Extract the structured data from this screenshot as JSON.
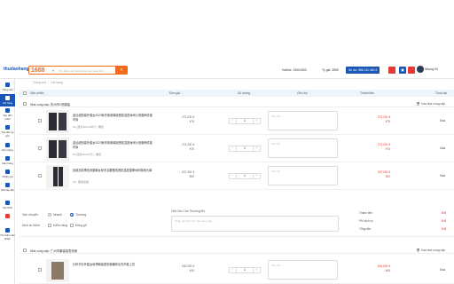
{
  "header": {
    "logo": "thudaohang",
    "search": {
      "source": "1688",
      "placeholder": "Tìm kiếm sản phẩm theo tên hoặc link..."
    },
    "hotline": "Hotline: 19001603",
    "rate": "Tỷ giá: 3595",
    "balance": "Số dư: 986,111,360 đ",
    "user": "Nhung Vũ"
  },
  "sidebar": {
    "items": [
      {
        "label": "Trang chủ"
      },
      {
        "label": "Giỏ hàng"
      },
      {
        "label": "Tạo đơn order"
      },
      {
        "label": "Tạo đơn ký gửi"
      },
      {
        "label": "Đơn hàng"
      },
      {
        "label": "Kiện hàng"
      },
      {
        "label": "Khiếu nại"
      },
      {
        "label": "Rút/nạp tiền"
      },
      {
        "label": "Tài chính"
      },
      {
        "label": "Tìm kiếm sản phẩm"
      }
    ]
  },
  "breadcrumb": {
    "home": "Trang chủ",
    "sep": "/",
    "current": "Giỏ hàng"
  },
  "table": {
    "headers": {
      "product": "Sản phẩm",
      "price": "Đơn giá",
      "qty": "Số lượng",
      "note": "Ghi chú",
      "total": "Thành tiền",
      "action": "Thao tác"
    }
  },
  "shops": [
    {
      "name": "Nhà cung cấp: 苏州市1号服装",
      "delete": "Xóa nhà cung cấp"
    },
    {
      "name": "Nhà cung cấp: 广州市服装批发商家",
      "delete": "Xóa nhà cung cấp"
    }
  ],
  "products": [
    {
      "title": "金丝绒西装外套女2023秋冬新款韩版宽松显瘦休闲小西服两件套时尚",
      "variant": "XL (建议120-140斤) ; 黑色",
      "price_cny": "¥76",
      "price_vnd": "273,200 đ",
      "qty": "1",
      "note_ph": "Ghi chú",
      "total_cny": "¥76",
      "total_vnd": "273,200 đ",
      "action": "Xóa"
    },
    {
      "title": "金丝绒西装外套女2023秋冬新款韩版宽松显瘦休闲小西服两件套时尚",
      "variant": "M (建议95-110斤) ; 黑色",
      "price_cny": "¥76",
      "price_vnd": "273,200 đ",
      "qty": "1",
      "note_ph": "Ghi chú",
      "total_cny": "¥76",
      "total_vnd": "273,200 đ",
      "action": "Xóa"
    },
    {
      "title": "加绒加厚黑色阔腿裤女秋冬高腰垂感宽松显瘦直筒休闲拖地长裤",
      "variant": "XL ; 黑色加绒",
      "price_cny": "¥52",
      "price_vnd": "187,300 đ",
      "qty": "1",
      "note_ph": "Ghi chú",
      "total_cny": "¥52",
      "total_vnd": "187,300 đ",
      "action": "Xóa"
    },
    {
      "title": "针织开衫外套女秋季韩版宽松慵懒风毛衣外套上衣",
      "variant": "",
      "price_cny": "¥45",
      "price_vnd": "160,000 đ",
      "qty": "1",
      "note_ph": "Ghi chú",
      "total_cny": "¥45",
      "total_vnd": "160,000 đ",
      "action": "Xóa"
    }
  ],
  "shipping": {
    "method_label": "Vận chuyển",
    "method_opts": [
      "Nhanh",
      "Thường"
    ],
    "services_label": "Dịch vụ thêm",
    "services": [
      "Kiểm hàng",
      "Đóng gỗ"
    ],
    "note_label": "Ghi Chú Cho Thương Đồ",
    "note_ph": "Nhập ghi chú cho nhà cung cấp...",
    "sum_labels": [
      "Thanh tiền",
      "Phí dịch vụ",
      "Tổng tiền"
    ],
    "sum_values": [
      "0 đ",
      "0 đ",
      "0 đ"
    ]
  },
  "colors": {
    "brand": "#1a56b8",
    "accent": "#f26a1b",
    "danger": "#e53935"
  }
}
